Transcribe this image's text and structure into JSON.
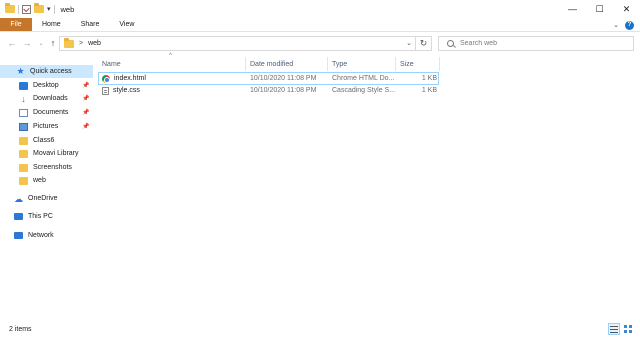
{
  "window": {
    "title": "web",
    "controls": {
      "minimize": "—",
      "maximize": "☐",
      "close": "✕"
    }
  },
  "ribbon": {
    "tabs": [
      "File",
      "Home",
      "Share",
      "View"
    ]
  },
  "address": {
    "path": [
      "web"
    ],
    "separator": ">",
    "search_placeholder": "Search web"
  },
  "sidebar": {
    "items": [
      {
        "label": "Quick access",
        "icon": "star-icon",
        "pinned": false,
        "selected": true
      },
      {
        "label": "Desktop",
        "icon": "desktop-icon",
        "pinned": true
      },
      {
        "label": "Downloads",
        "icon": "download-icon",
        "pinned": true
      },
      {
        "label": "Documents",
        "icon": "documents-icon",
        "pinned": true
      },
      {
        "label": "Pictures",
        "icon": "pictures-icon",
        "pinned": true
      },
      {
        "label": "Class6",
        "icon": "folder-icon"
      },
      {
        "label": "Movavi Library",
        "icon": "folder-icon"
      },
      {
        "label": "Screenshots",
        "icon": "folder-icon"
      },
      {
        "label": "web",
        "icon": "folder-icon"
      },
      {
        "label": "OneDrive",
        "icon": "cloud-icon"
      },
      {
        "label": "This PC",
        "icon": "pc-icon"
      },
      {
        "label": "Network",
        "icon": "network-icon"
      }
    ]
  },
  "columns": {
    "name": "Name",
    "date": "Date modified",
    "type": "Type",
    "size": "Size"
  },
  "files": [
    {
      "name": "index.html",
      "date": "10/10/2020 11:08 PM",
      "type": "Chrome HTML Do...",
      "size": "1 KB",
      "icon": "chrome-icon",
      "selected": true
    },
    {
      "name": "style.css",
      "date": "10/10/2020 11:08 PM",
      "type": "Cascading Style S...",
      "size": "1 KB",
      "icon": "css-file-icon",
      "selected": false
    }
  ],
  "status": {
    "item_count": "2 items"
  }
}
